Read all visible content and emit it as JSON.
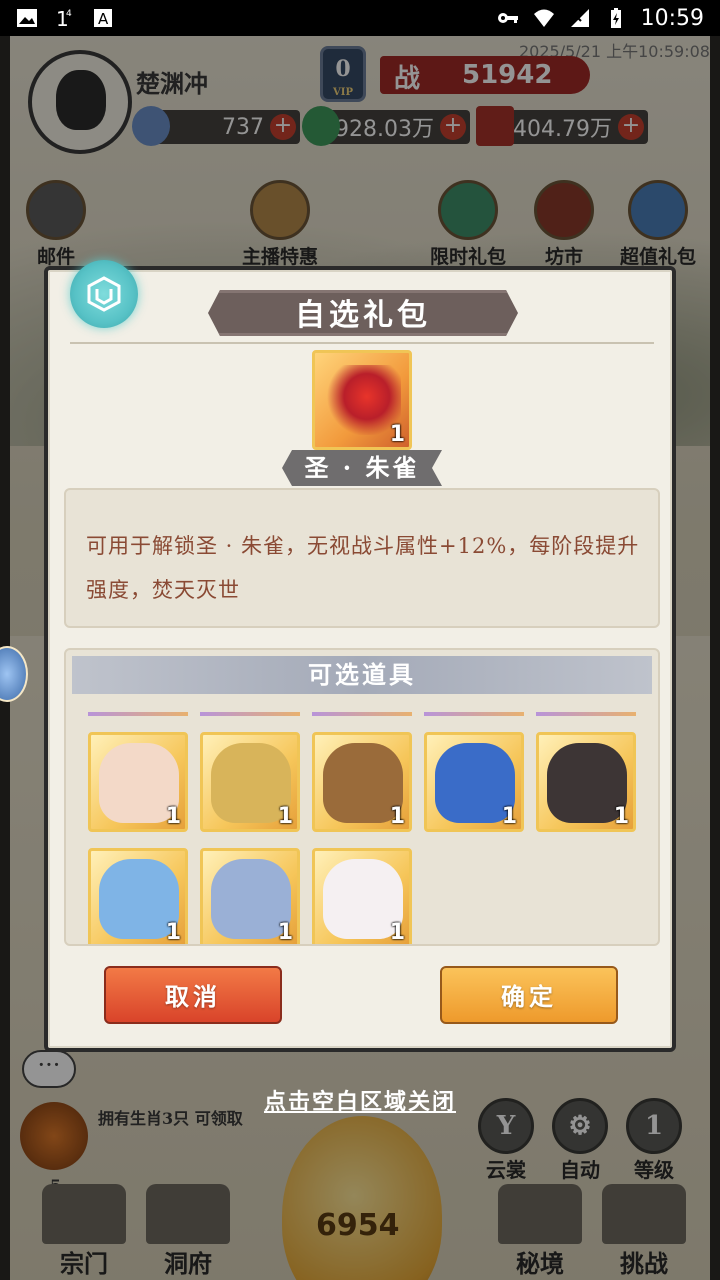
{
  "status_bar": {
    "time": "10:59",
    "left_icons": [
      "image-icon",
      "signal-4-icon",
      "font-a-icon"
    ],
    "right_icons": [
      "key-icon",
      "wifi-icon",
      "cellular-icon",
      "battery-icon"
    ]
  },
  "game": {
    "player_name": "楚渊冲",
    "timestamp": "2025/5/21 上午10:59:08",
    "vip_level": "0",
    "vip_label": "VIP",
    "power_label": "战",
    "power_value": "51942",
    "currencies": [
      {
        "icon": "feather-coin-icon",
        "value": "737"
      },
      {
        "icon": "jade-coin-icon",
        "value": "928.03万"
      },
      {
        "icon": "scroll-coin-icon",
        "value": "404.79万"
      }
    ],
    "top_icons": [
      {
        "label": "邮件",
        "icon": "mail-icon"
      },
      {
        "label": "主播特惠",
        "icon": "anchor-deal-icon"
      },
      {
        "label": "限时礼包",
        "icon": "timed-gift-icon"
      },
      {
        "label": "坊市",
        "icon": "market-icon"
      },
      {
        "label": "超值礼包",
        "icon": "value-gift-icon"
      }
    ],
    "zodiac_text": "拥有生肖3只 可领取",
    "zodiac_claim": "可领",
    "zodiac_level": "5",
    "egg_count": "6954",
    "round_buttons": [
      {
        "label": "云裳",
        "glyph": "Y"
      },
      {
        "label": "自动",
        "glyph": "⚙"
      },
      {
        "label": "等级",
        "glyph": "1"
      }
    ],
    "bottom_nav": [
      "宗门",
      "洞府",
      "秘境",
      "挑战"
    ],
    "close_hint": "点击空白区域关闭"
  },
  "dialog": {
    "title": "自选礼包",
    "item": {
      "name": "圣 · 朱雀",
      "quantity": "1"
    },
    "description": "可用于解锁圣 · 朱雀，无视战斗属性+12%，每阶段提升强度，焚天灭世",
    "options_title": "可选道具",
    "options": [
      {
        "icon": "white-lion-icon",
        "quantity": "1",
        "color": "#f3d9c8"
      },
      {
        "icon": "golden-dragon-icon",
        "quantity": "1",
        "color": "#d8b45a"
      },
      {
        "icon": "armored-tiger-icon",
        "quantity": "1",
        "color": "#9a6b3a"
      },
      {
        "icon": "blue-dragon-icon",
        "quantity": "1",
        "color": "#3a6cc8"
      },
      {
        "icon": "black-dragon-icon",
        "quantity": "1",
        "color": "#3d3535"
      },
      {
        "icon": "blue-horse-icon",
        "quantity": "1",
        "color": "#7fb4e6"
      },
      {
        "icon": "ram-icon",
        "quantity": "1",
        "color": "#9ab0d6"
      },
      {
        "icon": "white-rabbit-icon",
        "quantity": "1",
        "color": "#f5f0f2"
      }
    ],
    "cancel_label": "取消",
    "confirm_label": "确定"
  }
}
